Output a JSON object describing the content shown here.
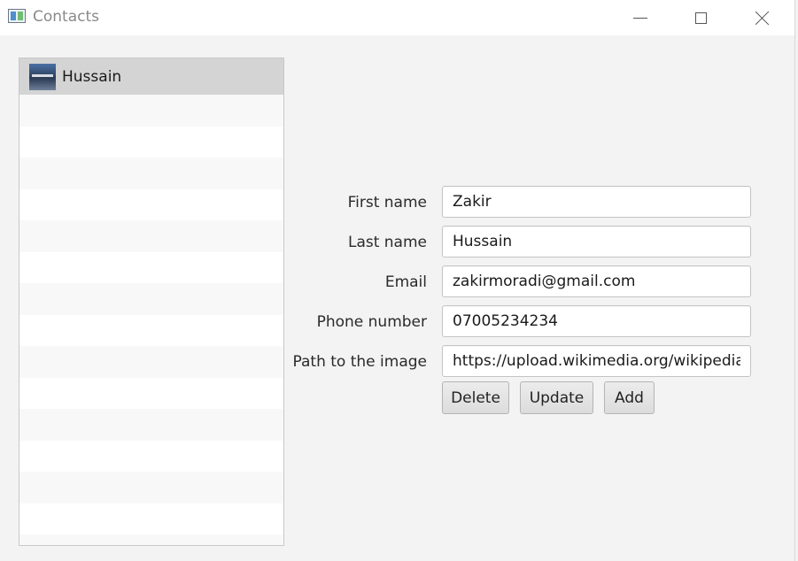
{
  "window": {
    "title": "Contacts",
    "app_icon": "contacts-app-icon",
    "controls": {
      "minimize_icon": "minimize-icon",
      "maximize_icon": "maximize-icon",
      "close_icon": "close-icon"
    }
  },
  "contacts_list": {
    "items": [
      {
        "name": "Hussain",
        "avatar": "contact-photo",
        "selected": true
      }
    ],
    "selected_color": "#d4d4d4",
    "stripe_color": "#f8f8f8"
  },
  "form": {
    "first_name": {
      "label": "First name",
      "value": "Zakir"
    },
    "last_name": {
      "label": "Last name",
      "value": "Hussain"
    },
    "email": {
      "label": "Email",
      "value": "zakirmoradi@gmail.com"
    },
    "phone": {
      "label": "Phone number",
      "value": "07005234234"
    },
    "image_path": {
      "label": "Path to the image",
      "value": "https://upload.wikimedia.org/wikipedia/c"
    }
  },
  "buttons": {
    "delete": "Delete",
    "update": "Update",
    "add": "Add"
  }
}
